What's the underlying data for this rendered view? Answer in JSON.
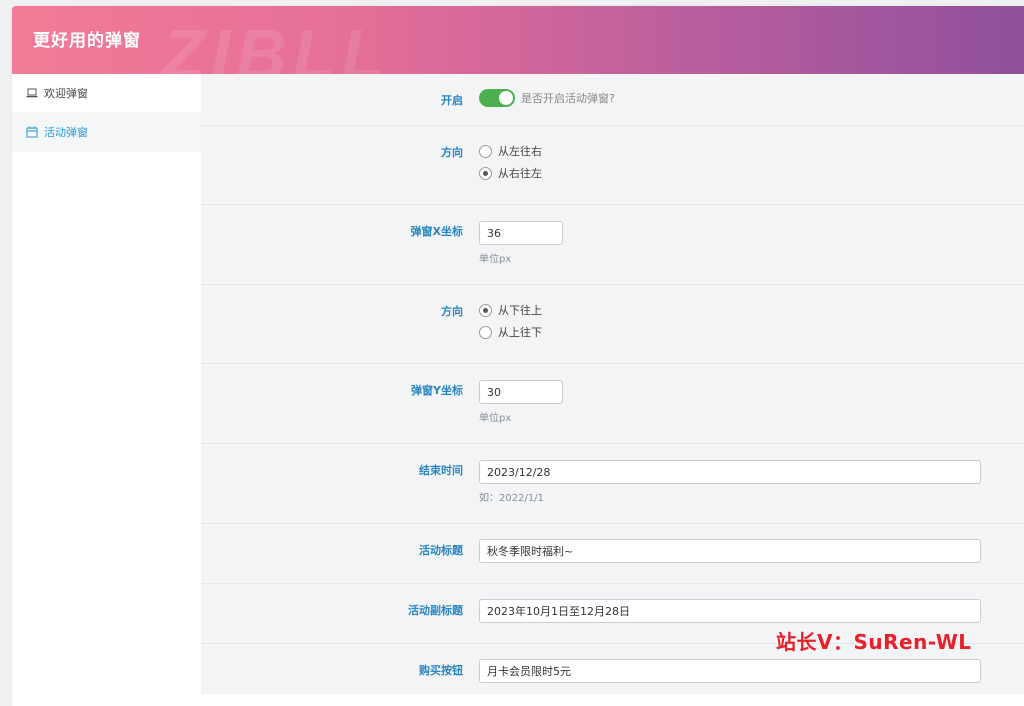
{
  "header": {
    "title": "更好用的弹窗",
    "watermark": "ZIBLL"
  },
  "sidebar": {
    "items": [
      {
        "label": "欢迎弹窗",
        "icon": "laptop-icon",
        "active": false
      },
      {
        "label": "活动弹窗",
        "icon": "calendar-icon",
        "active": true
      }
    ]
  },
  "form": {
    "enable": {
      "label": "开启",
      "on": true,
      "hint": "是否开启活动弹窗?"
    },
    "direction_x": {
      "label": "方向",
      "options": [
        "从左往右",
        "从右往左"
      ],
      "selected": "从右往左"
    },
    "pos_x": {
      "label": "弹窗X坐标",
      "value": "36",
      "unit": "单位px"
    },
    "direction_y": {
      "label": "方向",
      "options": [
        "从下往上",
        "从上往下"
      ],
      "selected": "从下往上"
    },
    "pos_y": {
      "label": "弹窗Y坐标",
      "value": "30",
      "unit": "单位px"
    },
    "end_time": {
      "label": "结束时间",
      "value": "2023/12/28",
      "example": "如：2022/1/1"
    },
    "title": {
      "label": "活动标题",
      "value": "秋冬季限时福利~"
    },
    "subtitle": {
      "label": "活动副标题",
      "value": "2023年10月1日至12月28日"
    },
    "buy_button": {
      "label": "购买按钮",
      "value": "月卡会员限时5元"
    }
  },
  "overlay": {
    "text": "站长V：SuRen-WL"
  },
  "colors": {
    "accent": "#2a86c0",
    "toggle_on": "#4cb04f",
    "overlay": "#e8202a"
  }
}
